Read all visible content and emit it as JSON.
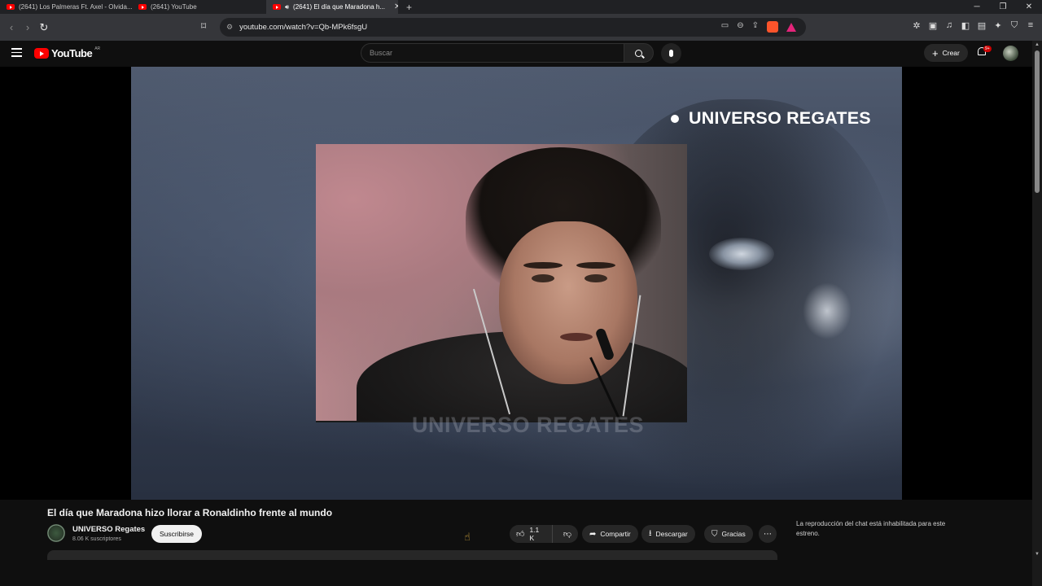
{
  "browser": {
    "tabs": [
      {
        "title": "(2641) Los Palmeras Ft. Axel - Olvida..."
      },
      {
        "title": "(2641) YouTube"
      },
      {
        "title": "(2641) El día que Maradona h..."
      }
    ],
    "url": "youtube.com/watch?v=Qb-MPk6fsgU"
  },
  "youtube": {
    "logo_text": "YouTube",
    "logo_region": "AR",
    "search_placeholder": "Buscar",
    "create_label": "Crear",
    "notifications_badge": "9+"
  },
  "video": {
    "overlay_brand": "UNIVERSO REGATES",
    "watermark": "UNIVERSO REGATES",
    "title": "El día que Maradona hizo llorar a Ronaldinho frente al mundo"
  },
  "channel": {
    "name": "UNIVERSO Regates",
    "subscribers": "8.06 K suscriptores",
    "subscribe_label": "Suscribirse"
  },
  "actions": {
    "likes": "1.1 K",
    "share_label": "Compartir",
    "download_label": "Descargar",
    "thanks_label": "Gracias"
  },
  "chat": {
    "message": "La reproducción del chat está inhabilitada para este estreno."
  },
  "colors": {
    "brand_red": "#ff0000",
    "background": "#0f0f0f",
    "pill": "#272727"
  }
}
